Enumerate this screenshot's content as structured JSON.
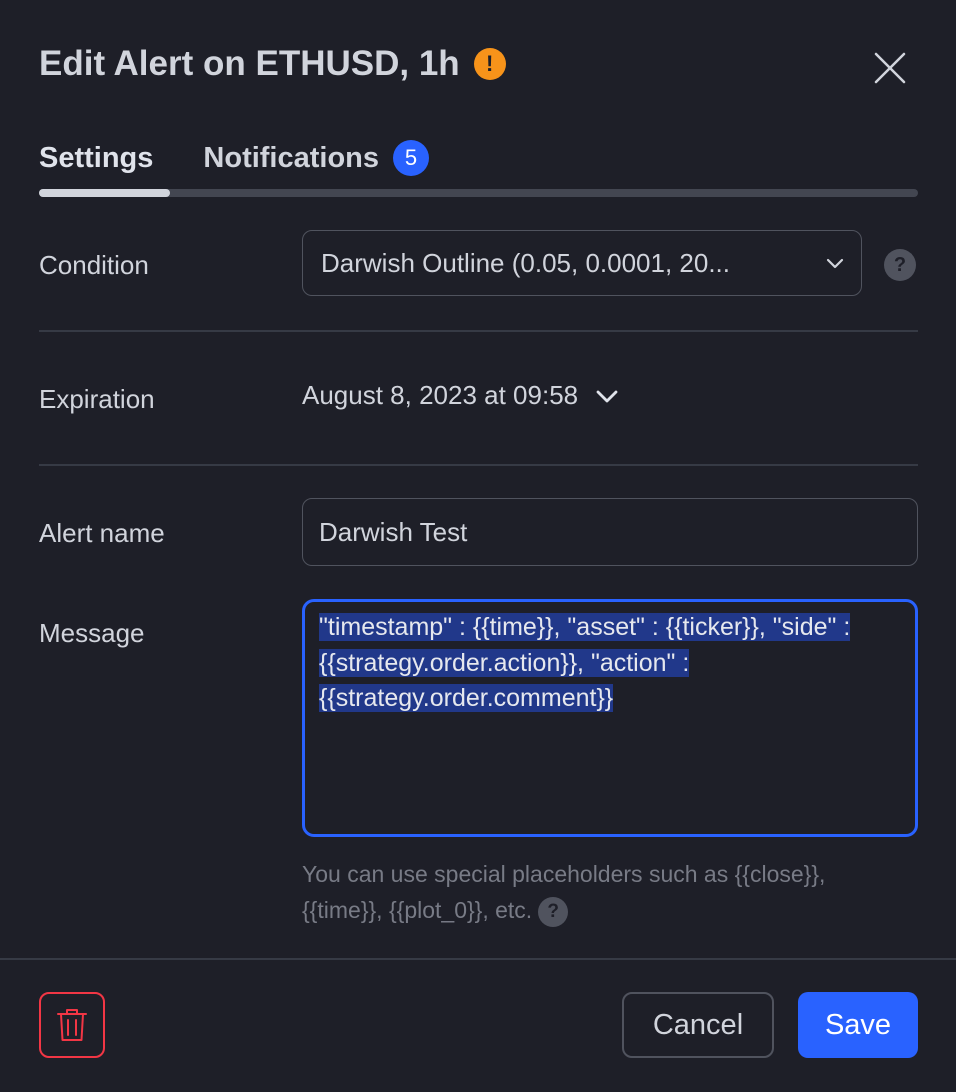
{
  "dialog": {
    "title": "Edit Alert on ETHUSD, 1h",
    "warning_glyph": "!",
    "close_icon": "close-icon",
    "colors": {
      "accent": "#2962ff",
      "warning": "#f7931a",
      "danger": "#f23645",
      "background": "#1e1f28"
    }
  },
  "tabs": {
    "settings": "Settings",
    "notifications": "Notifications",
    "notifications_count": "5",
    "active": "Settings"
  },
  "condition": {
    "label": "Condition",
    "value": "Darwish Outline (0.05, 0.0001, 20...",
    "help_glyph": "?"
  },
  "expiration": {
    "label": "Expiration",
    "value": "August 8, 2023 at 09:58"
  },
  "alert_name": {
    "label": "Alert name",
    "value": "Darwish Test"
  },
  "message": {
    "label": "Message",
    "value": "\"timestamp\" : {{time}}, \"asset\" : {{ticker}}, \"side\" : {{strategy.order.action}}, \"action\" : {{strategy.order.comment}}",
    "selected": true
  },
  "hint": {
    "text": "You can use special placeholders such as {{close}}, {{time}}, {{plot_0}}, etc.",
    "help_glyph": "?"
  },
  "footer": {
    "delete_icon": "trash-icon",
    "cancel": "Cancel",
    "save": "Save"
  }
}
